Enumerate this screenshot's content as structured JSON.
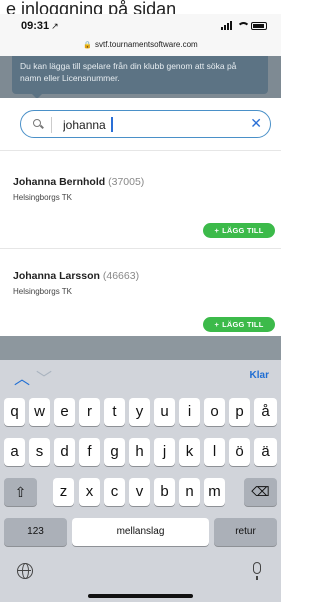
{
  "caption": "e inloggning på sidan",
  "status": {
    "time": "09:31"
  },
  "browser": {
    "url": "svtf.tournamentsoftware.com"
  },
  "tooltip": {
    "text": "Du kan lägga till spelare från din klubb genom att söka på namn eller Licensnummer."
  },
  "search": {
    "value": "johanna "
  },
  "results": [
    {
      "name": "Johanna Bernhold",
      "id": "(37005)",
      "club": "Helsingborgs TK",
      "add_label": "LÄGG TILL"
    },
    {
      "name": "Johanna Larsson",
      "id": "(46663)",
      "club": "Helsingborgs TK",
      "add_label": "LÄGG TILL"
    }
  ],
  "keyboard": {
    "done_label": "Klar",
    "row1": [
      "q",
      "w",
      "e",
      "r",
      "t",
      "y",
      "u",
      "i",
      "o",
      "p",
      "å"
    ],
    "row2": [
      "a",
      "s",
      "d",
      "f",
      "g",
      "h",
      "j",
      "k",
      "l",
      "ö",
      "ä"
    ],
    "row3": [
      "z",
      "x",
      "c",
      "v",
      "b",
      "n",
      "m"
    ],
    "numbers_label": "123",
    "space_label": "mellanslag",
    "return_label": "retur"
  },
  "colors": {
    "accent": "#1f6ed3",
    "add_button": "#3cba4a",
    "tooltip_bg": "#5c7384"
  }
}
